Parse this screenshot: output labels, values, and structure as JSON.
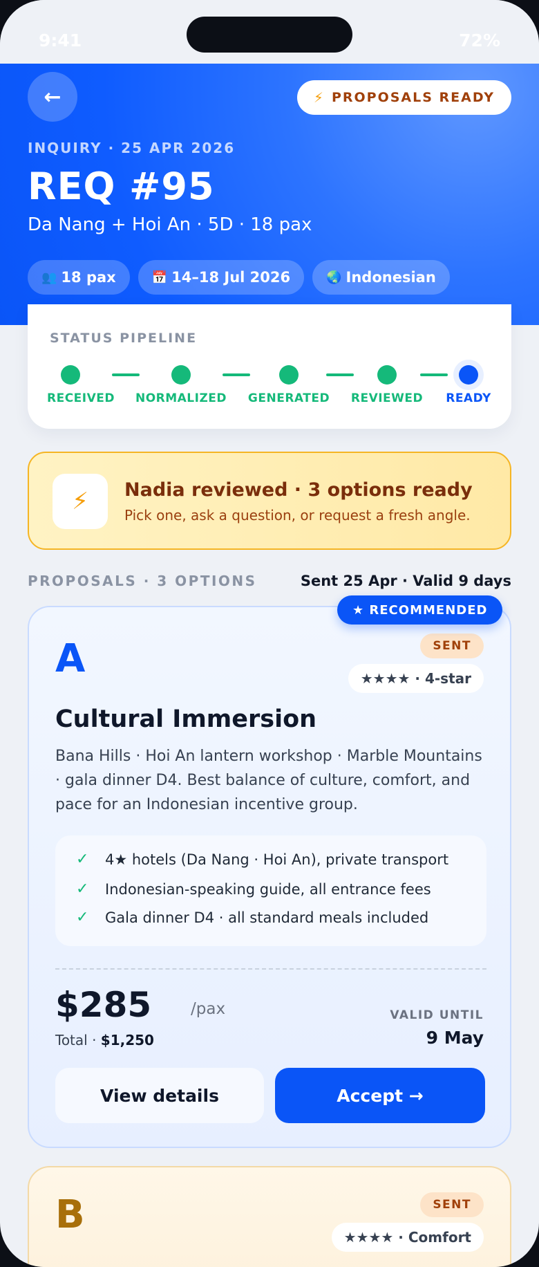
{
  "status_bar": {
    "time": "9:41",
    "battery": "72%"
  },
  "header": {
    "back_icon": "←",
    "status_pill": {
      "icon": "⚡",
      "label": "PROPOSALS READY"
    },
    "inquiry_date": "INQUIRY · 25 APR 2026",
    "title": "REQ #95",
    "subtitle": "Da Nang + Hoi An · 5D · 18 pax",
    "chips": [
      {
        "icon": "👥",
        "label": "18 pax"
      },
      {
        "icon": "📅",
        "label": "14–18 Jul 2026"
      },
      {
        "icon": "🌏",
        "label": "Indonesian"
      }
    ]
  },
  "pipeline": {
    "title": "STATUS PIPELINE",
    "steps": [
      {
        "label": "RECEIVED",
        "state": "done"
      },
      {
        "label": "NORMALIZED",
        "state": "done"
      },
      {
        "label": "GENERATED",
        "state": "done"
      },
      {
        "label": "REVIEWED",
        "state": "done"
      },
      {
        "label": "READY",
        "state": "current"
      }
    ]
  },
  "notice": {
    "icon": "⚡",
    "title": "Nadia reviewed · 3 options ready",
    "subtitle": "Pick one, ask a question, or request a fresh angle."
  },
  "proposals": {
    "header": "PROPOSALS · 3 OPTIONS",
    "meta": "Sent 25 Apr · Valid 9 days",
    "cards": [
      {
        "letter": "A",
        "recommended": "★ RECOMMENDED",
        "status": "SENT",
        "rating": "★★★★ · 4-star",
        "title": "Cultural Immersion",
        "description": "Bana Hills · Hoi An lantern workshop · Marble Mountains · gala dinner D4. Best balance of culture, comfort, and pace for an Indonesian incentive group.",
        "inclusions": [
          "4★ hotels (Da Nang · Hoi An), private transport",
          "Indonesian-speaking guide, all entrance fees",
          "Gala dinner D4 · all standard meals included"
        ],
        "price": "$285",
        "per": "/pax",
        "total_label": "Total ·",
        "total_value": "$1,250",
        "valid_label": "VALID UNTIL",
        "valid_date": "9 May",
        "details_button": "View details",
        "accept_button": "Accept →"
      },
      {
        "letter": "B",
        "status": "SENT",
        "rating": "★★★★ · Comfort"
      }
    ]
  },
  "colors": {
    "primary": "#0a55f7",
    "success": "#15b97a",
    "warning": "#f5b524",
    "text": "#0f172a"
  }
}
